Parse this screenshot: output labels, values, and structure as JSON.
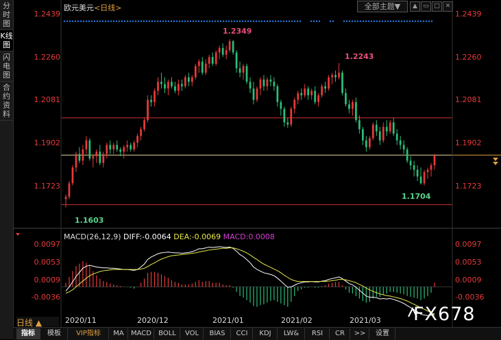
{
  "sidebar": {
    "items": [
      {
        "label": "分时图",
        "active": false
      },
      {
        "label": "K线图",
        "active": true
      },
      {
        "label": "闪电图",
        "active": false
      },
      {
        "label": "合约资料",
        "active": false
      }
    ]
  },
  "header": {
    "symbol": "欧元美元",
    "period": "<日线>",
    "theme_button": "全部主题▼"
  },
  "price_axis": {
    "ticks": [
      "1.2439",
      "1.2260",
      "1.2081",
      "1.1902",
      "1.1723"
    ]
  },
  "annotations": {
    "high1": "1.2349",
    "high2": "1.2243",
    "low1": "1.1603",
    "low2": "1.1704"
  },
  "macd": {
    "title": "MACD(26,12,9)",
    "diff": "DIFF:-0.0064",
    "dea": "DEA:-0.0069",
    "macd": "MACD:0.0008",
    "ticks": [
      "0.0097",
      "0.0053",
      "0.0009",
      "-0.0036"
    ]
  },
  "x_axis": {
    "period_selector": "日线 ▲",
    "labels": [
      "2020/11",
      "2020/12",
      "2021/01",
      "2021/02",
      "2021/03"
    ]
  },
  "tabs": [
    "指标",
    "模板",
    "VIP指标",
    "MA",
    "MACD",
    "BOLL",
    "VOL",
    "BIAS",
    "CCI",
    "KDJ",
    "LW&",
    "RSI",
    "CR",
    ">>",
    "设置"
  ],
  "watermark": "FX678",
  "colors": {
    "up": "#e83a3a",
    "down": "#2bbf7a",
    "diff_line": "#ffffff",
    "dea_line": "#e8e84a",
    "macd_text": "#d040d0",
    "dots": "#2a7be0"
  },
  "chart_data": {
    "type": "candlestick",
    "title": "欧元美元 <日线>",
    "ylim": [
      1.155,
      1.248
    ],
    "yticks": [
      1.2439,
      1.226,
      1.2081,
      1.1902,
      1.1723
    ],
    "hlines": [
      1.2,
      1.1835,
      1.1615
    ],
    "last_close": 1.1835,
    "ohlc": [
      [
        1.164,
        1.166,
        1.1603,
        1.165
      ],
      [
        1.165,
        1.172,
        1.164,
        1.171
      ],
      [
        1.171,
        1.179,
        1.17,
        1.178
      ],
      [
        1.178,
        1.185,
        1.176,
        1.184
      ],
      [
        1.184,
        1.187,
        1.18,
        1.181
      ],
      [
        1.181,
        1.188,
        1.179,
        1.186
      ],
      [
        1.186,
        1.192,
        1.184,
        1.19
      ],
      [
        1.19,
        1.191,
        1.181,
        1.182
      ],
      [
        1.182,
        1.184,
        1.178,
        1.183
      ],
      [
        1.183,
        1.186,
        1.18,
        1.185
      ],
      [
        1.185,
        1.188,
        1.179,
        1.18
      ],
      [
        1.18,
        1.185,
        1.178,
        1.184
      ],
      [
        1.184,
        1.189,
        1.182,
        1.188
      ],
      [
        1.188,
        1.19,
        1.184,
        1.186
      ],
      [
        1.186,
        1.189,
        1.184,
        1.188
      ],
      [
        1.188,
        1.19,
        1.185,
        1.186
      ],
      [
        1.186,
        1.187,
        1.183,
        1.185
      ],
      [
        1.185,
        1.188,
        1.182,
        1.187
      ],
      [
        1.187,
        1.19,
        1.185,
        1.188
      ],
      [
        1.188,
        1.189,
        1.185,
        1.186
      ],
      [
        1.186,
        1.19,
        1.185,
        1.189
      ],
      [
        1.189,
        1.193,
        1.187,
        1.192
      ],
      [
        1.192,
        1.196,
        1.19,
        1.195
      ],
      [
        1.195,
        1.2,
        1.194,
        1.199
      ],
      [
        1.199,
        1.21,
        1.198,
        1.208
      ],
      [
        1.208,
        1.21,
        1.205,
        1.207
      ],
      [
        1.207,
        1.213,
        1.205,
        1.212
      ],
      [
        1.212,
        1.218,
        1.21,
        1.216
      ],
      [
        1.216,
        1.22,
        1.213,
        1.215
      ],
      [
        1.215,
        1.218,
        1.211,
        1.213
      ],
      [
        1.213,
        1.217,
        1.21,
        1.216
      ],
      [
        1.216,
        1.218,
        1.213,
        1.214
      ],
      [
        1.214,
        1.216,
        1.211,
        1.212
      ],
      [
        1.212,
        1.217,
        1.21,
        1.215
      ],
      [
        1.215,
        1.217,
        1.212,
        1.214
      ],
      [
        1.214,
        1.219,
        1.213,
        1.218
      ],
      [
        1.218,
        1.22,
        1.214,
        1.216
      ],
      [
        1.216,
        1.219,
        1.214,
        1.218
      ],
      [
        1.218,
        1.224,
        1.217,
        1.223
      ],
      [
        1.223,
        1.226,
        1.22,
        1.225
      ],
      [
        1.225,
        1.227,
        1.219,
        1.22
      ],
      [
        1.22,
        1.226,
        1.219,
        1.224
      ],
      [
        1.224,
        1.228,
        1.222,
        1.227
      ],
      [
        1.227,
        1.229,
        1.223,
        1.224
      ],
      [
        1.224,
        1.23,
        1.223,
        1.229
      ],
      [
        1.229,
        1.232,
        1.226,
        1.231
      ],
      [
        1.231,
        1.233,
        1.227,
        1.228
      ],
      [
        1.228,
        1.232,
        1.226,
        1.23
      ],
      [
        1.23,
        1.2349,
        1.229,
        1.234
      ],
      [
        1.234,
        1.2345,
        1.228,
        1.229
      ],
      [
        1.229,
        1.23,
        1.22,
        1.222
      ],
      [
        1.222,
        1.225,
        1.218,
        1.22
      ],
      [
        1.22,
        1.224,
        1.217,
        1.223
      ],
      [
        1.223,
        1.224,
        1.215,
        1.216
      ],
      [
        1.216,
        1.218,
        1.211,
        1.213
      ],
      [
        1.213,
        1.216,
        1.206,
        1.208
      ],
      [
        1.208,
        1.214,
        1.207,
        1.213
      ],
      [
        1.213,
        1.218,
        1.21,
        1.217
      ],
      [
        1.217,
        1.219,
        1.212,
        1.214
      ],
      [
        1.214,
        1.218,
        1.212,
        1.217
      ],
      [
        1.217,
        1.219,
        1.214,
        1.216
      ],
      [
        1.216,
        1.218,
        1.212,
        1.214
      ],
      [
        1.214,
        1.215,
        1.205,
        1.207
      ],
      [
        1.207,
        1.208,
        1.201,
        1.204
      ],
      [
        1.204,
        1.205,
        1.196,
        1.198
      ],
      [
        1.198,
        1.2,
        1.1955,
        1.197
      ],
      [
        1.197,
        1.205,
        1.196,
        1.204
      ],
      [
        1.204,
        1.209,
        1.202,
        1.208
      ],
      [
        1.208,
        1.212,
        1.206,
        1.211
      ],
      [
        1.211,
        1.213,
        1.208,
        1.21
      ],
      [
        1.21,
        1.215,
        1.209,
        1.213
      ],
      [
        1.213,
        1.214,
        1.208,
        1.21
      ],
      [
        1.21,
        1.213,
        1.208,
        1.212
      ],
      [
        1.212,
        1.214,
        1.206,
        1.207
      ],
      [
        1.207,
        1.211,
        1.205,
        1.21
      ],
      [
        1.21,
        1.215,
        1.209,
        1.214
      ],
      [
        1.214,
        1.216,
        1.211,
        1.213
      ],
      [
        1.213,
        1.219,
        1.212,
        1.218
      ],
      [
        1.218,
        1.22,
        1.215,
        1.219
      ],
      [
        1.219,
        1.221,
        1.216,
        1.218
      ],
      [
        1.218,
        1.2243,
        1.217,
        1.22
      ],
      [
        1.22,
        1.221,
        1.21,
        1.211
      ],
      [
        1.211,
        1.213,
        1.205,
        1.206
      ],
      [
        1.206,
        1.208,
        1.202,
        1.204
      ],
      [
        1.204,
        1.208,
        1.201,
        1.207
      ],
      [
        1.207,
        1.209,
        1.198,
        1.199
      ],
      [
        1.199,
        1.201,
        1.193,
        1.195
      ],
      [
        1.195,
        1.196,
        1.188,
        1.19
      ],
      [
        1.19,
        1.192,
        1.185,
        1.187
      ],
      [
        1.187,
        1.192,
        1.186,
        1.191
      ],
      [
        1.191,
        1.198,
        1.19,
        1.197
      ],
      [
        1.197,
        1.199,
        1.192,
        1.194
      ],
      [
        1.194,
        1.196,
        1.188,
        1.19
      ],
      [
        1.19,
        1.198,
        1.189,
        1.196
      ],
      [
        1.196,
        1.199,
        1.192,
        1.194
      ],
      [
        1.194,
        1.199,
        1.193,
        1.198
      ],
      [
        1.198,
        1.2,
        1.192,
        1.193
      ],
      [
        1.193,
        1.195,
        1.188,
        1.19
      ],
      [
        1.19,
        1.192,
        1.186,
        1.188
      ],
      [
        1.188,
        1.19,
        1.184,
        1.186
      ],
      [
        1.186,
        1.187,
        1.18,
        1.181
      ],
      [
        1.181,
        1.183,
        1.177,
        1.179
      ],
      [
        1.179,
        1.181,
        1.174,
        1.177
      ],
      [
        1.177,
        1.179,
        1.172,
        1.174
      ],
      [
        1.174,
        1.178,
        1.1704,
        1.171
      ],
      [
        1.171,
        1.177,
        1.17,
        1.176
      ],
      [
        1.176,
        1.178,
        1.173,
        1.177
      ],
      [
        1.177,
        1.18,
        1.174,
        1.179
      ],
      [
        1.179,
        1.184,
        1.177,
        1.1835
      ]
    ],
    "macd_series": {
      "diff": [
        -0.001,
        0.0,
        0.0012,
        0.0025,
        0.0035,
        0.0045,
        0.005,
        0.0052,
        0.005,
        0.0048,
        0.0047,
        0.0046,
        0.0046,
        0.0045,
        0.0045,
        0.0044,
        0.0043,
        0.0042,
        0.0042,
        0.0041,
        0.004,
        0.0042,
        0.0048,
        0.0055,
        0.0066,
        0.0072,
        0.0076,
        0.008,
        0.0082,
        0.0083,
        0.0084,
        0.0083,
        0.0082,
        0.0082,
        0.0081,
        0.0082,
        0.0083,
        0.0085,
        0.0088,
        0.0092,
        0.0092,
        0.0094,
        0.0096,
        0.0095,
        0.0096,
        0.0097,
        0.0096,
        0.0095,
        0.0096,
        0.0093,
        0.0086,
        0.0078,
        0.0073,
        0.0066,
        0.0058,
        0.0048,
        0.0042,
        0.0038,
        0.0034,
        0.0032,
        0.003,
        0.0027,
        0.0021,
        0.0014,
        0.0006,
        -0.0001,
        0.0,
        0.0004,
        0.0008,
        0.001,
        0.0012,
        0.0012,
        0.0013,
        0.0012,
        0.0012,
        0.0014,
        0.0015,
        0.0018,
        0.002,
        0.0022,
        0.0024,
        0.002,
        0.0014,
        0.0008,
        0.0005,
        -0.0001,
        -0.0008,
        -0.0015,
        -0.0022,
        -0.0025,
        -0.0025,
        -0.0026,
        -0.0029,
        -0.0028,
        -0.0029,
        -0.0028,
        -0.003,
        -0.0033,
        -0.0036,
        -0.004,
        -0.0045,
        -0.005,
        -0.0055,
        -0.006,
        -0.0066,
        -0.0068,
        -0.0069,
        -0.0068,
        -0.0064
      ],
      "dea": [
        -0.0015,
        -0.0012,
        -0.0007,
        0.0,
        0.0007,
        0.0014,
        0.0021,
        0.0027,
        0.0031,
        0.0034,
        0.0037,
        0.0039,
        0.004,
        0.0041,
        0.0042,
        0.0042,
        0.0042,
        0.0042,
        0.0042,
        0.0042,
        0.0042,
        0.0042,
        0.0043,
        0.0045,
        0.0049,
        0.0054,
        0.0058,
        0.0063,
        0.0067,
        0.007,
        0.0073,
        0.0075,
        0.0076,
        0.0077,
        0.0078,
        0.0079,
        0.008,
        0.0081,
        0.0082,
        0.0084,
        0.0086,
        0.0087,
        0.0089,
        0.009,
        0.0091,
        0.0092,
        0.0093,
        0.0093,
        0.0094,
        0.0094,
        0.0092,
        0.0089,
        0.0086,
        0.0082,
        0.0077,
        0.0071,
        0.0066,
        0.006,
        0.0055,
        0.0051,
        0.0047,
        0.0043,
        0.0039,
        0.0034,
        0.0028,
        0.0023,
        0.0018,
        0.0015,
        0.0013,
        0.0013,
        0.0013,
        0.0013,
        0.0013,
        0.0013,
        0.0013,
        0.0013,
        0.0013,
        0.0014,
        0.0015,
        0.0016,
        0.0018,
        0.0018,
        0.0017,
        0.0015,
        0.0013,
        0.001,
        0.0006,
        0.0002,
        -0.0003,
        -0.0007,
        -0.0011,
        -0.0014,
        -0.0017,
        -0.0019,
        -0.0021,
        -0.0022,
        -0.0024,
        -0.0026,
        -0.0028,
        -0.0031,
        -0.0034,
        -0.0038,
        -0.0042,
        -0.0046,
        -0.005,
        -0.0054,
        -0.0058,
        -0.0061,
        -0.0069
      ]
    }
  }
}
